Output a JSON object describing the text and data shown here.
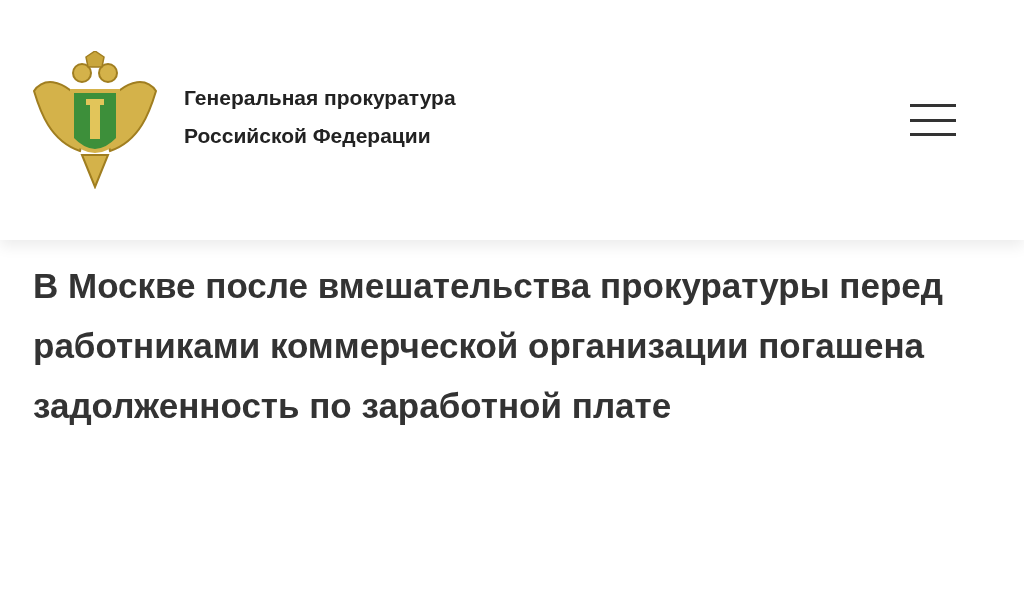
{
  "header": {
    "title_lines": [
      "Генеральная прокуратура",
      "Российской Федерации"
    ]
  },
  "article": {
    "headline": "В Москве после вмешательства прокуратуры перед работниками коммерческой организации погашена задолженность по заработной плате"
  }
}
